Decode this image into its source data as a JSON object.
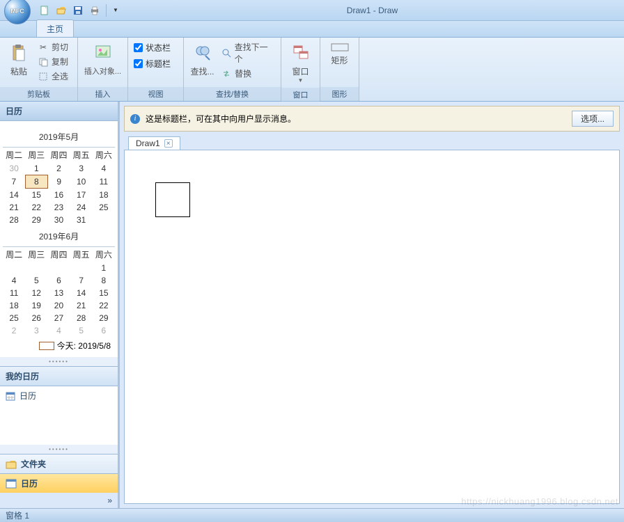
{
  "app": {
    "title": "Draw1 - Draw",
    "orb_text": "MFC"
  },
  "qat": {
    "new": "new-icon",
    "open": "open-icon",
    "save": "save-icon",
    "print": "print-icon"
  },
  "tabs": {
    "home": "主页"
  },
  "ribbon": {
    "clipboard": {
      "label": "剪贴板",
      "paste": "粘贴",
      "cut": "剪切",
      "copy": "复制",
      "select_all": "全选"
    },
    "insert": {
      "label": "插入",
      "insert_obj": "插入对象..."
    },
    "view": {
      "label": "视图",
      "status_bar": "状态栏",
      "title_bar": "标题栏"
    },
    "find": {
      "label": "查找/替换",
      "find": "查找...",
      "find_next": "查找下一个",
      "replace": "替换"
    },
    "window": {
      "label": "窗口",
      "window": "窗口"
    },
    "shapes": {
      "label": "图形",
      "rect": "矩形"
    }
  },
  "infobar": {
    "text": "这是标题栏，可在其中向用户显示消息。",
    "options": "选项..."
  },
  "doc": {
    "tab": "Draw1"
  },
  "sidebar": {
    "title": "日历",
    "month1": {
      "header": "2019年5月",
      "dow": [
        "周二",
        "周三",
        "周四",
        "周五",
        "周六"
      ],
      "rows": [
        [
          {
            "d": "30",
            "g": true
          },
          {
            "d": "1"
          },
          {
            "d": "2"
          },
          {
            "d": "3"
          },
          {
            "d": "4"
          }
        ],
        [
          {
            "d": "7"
          },
          {
            "d": "8",
            "t": true
          },
          {
            "d": "9"
          },
          {
            "d": "10"
          },
          {
            "d": "11"
          }
        ],
        [
          {
            "d": "14"
          },
          {
            "d": "15"
          },
          {
            "d": "16"
          },
          {
            "d": "17"
          },
          {
            "d": "18"
          }
        ],
        [
          {
            "d": "21"
          },
          {
            "d": "22"
          },
          {
            "d": "23"
          },
          {
            "d": "24"
          },
          {
            "d": "25"
          }
        ],
        [
          {
            "d": "28"
          },
          {
            "d": "29"
          },
          {
            "d": "30"
          },
          {
            "d": "31"
          },
          {
            "d": ""
          }
        ]
      ]
    },
    "month2": {
      "header": "2019年6月",
      "dow": [
        "周二",
        "周三",
        "周四",
        "周五",
        "周六"
      ],
      "rows": [
        [
          {
            "d": ""
          },
          {
            "d": ""
          },
          {
            "d": ""
          },
          {
            "d": ""
          },
          {
            "d": "1"
          }
        ],
        [
          {
            "d": "4"
          },
          {
            "d": "5"
          },
          {
            "d": "6"
          },
          {
            "d": "7"
          },
          {
            "d": "8"
          }
        ],
        [
          {
            "d": "11"
          },
          {
            "d": "12"
          },
          {
            "d": "13"
          },
          {
            "d": "14"
          },
          {
            "d": "15"
          }
        ],
        [
          {
            "d": "18"
          },
          {
            "d": "19"
          },
          {
            "d": "20"
          },
          {
            "d": "21"
          },
          {
            "d": "22"
          }
        ],
        [
          {
            "d": "25"
          },
          {
            "d": "26"
          },
          {
            "d": "27"
          },
          {
            "d": "28"
          },
          {
            "d": "29"
          }
        ],
        [
          {
            "d": "2",
            "g": true
          },
          {
            "d": "3",
            "g": true
          },
          {
            "d": "4",
            "g": true
          },
          {
            "d": "5",
            "g": true
          },
          {
            "d": "6",
            "g": true
          }
        ]
      ]
    },
    "today": "今天: 2019/5/8",
    "my_cal": "我的日历",
    "cal_item": "日历",
    "folder": "文件夹",
    "cal_nav": "日历"
  },
  "status": {
    "text": "窗格 1"
  },
  "watermark": "https://nickhuang1996.blog.csdn.net"
}
